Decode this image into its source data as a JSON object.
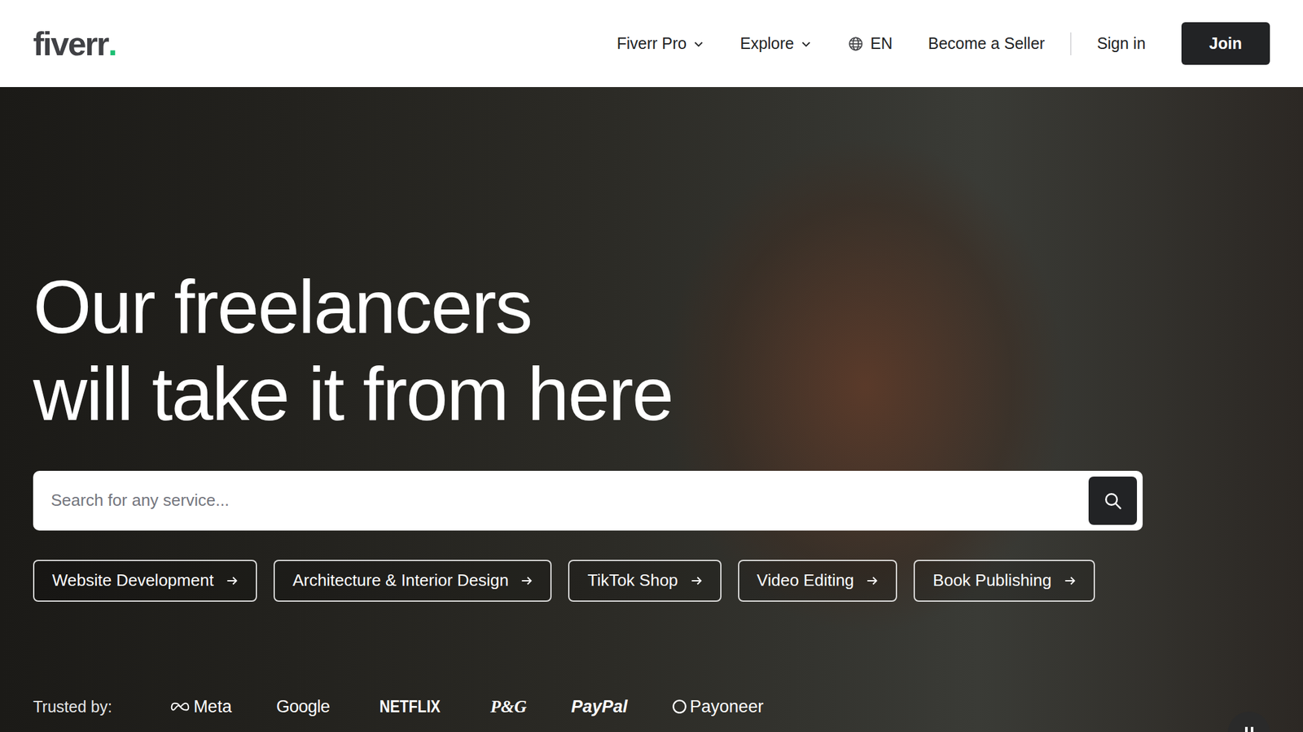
{
  "brand": {
    "name": "fiverr",
    "dot": "."
  },
  "nav": [
    {
      "label": "Fiverr Pro",
      "kind": "dropdown"
    },
    {
      "label": "Explore",
      "kind": "dropdown"
    },
    {
      "label": "EN",
      "kind": "language"
    },
    {
      "label": "Become a Seller",
      "kind": "link"
    },
    {
      "label": "Sign in",
      "kind": "link"
    }
  ],
  "join_button": "Join",
  "hero": {
    "headline": [
      "Our freelancers",
      "will take it from here"
    ]
  },
  "search": {
    "placeholder": "Search for any service..."
  },
  "chips": [
    "Website Development",
    "Architecture & Interior Design",
    "TikTok Shop",
    "Video Editing",
    "Book Publishing"
  ],
  "trusted": {
    "label": "Trusted by:",
    "logos": [
      {
        "name": "Meta",
        "kind": "meta"
      },
      {
        "name": "Google",
        "kind": "google"
      },
      {
        "name": "NETFLIX",
        "kind": "netflix"
      },
      {
        "name": "P&G",
        "kind": "pg"
      },
      {
        "name": "PayPal",
        "kind": "paypal"
      },
      {
        "name": "Payoneer",
        "kind": "payoneer"
      }
    ]
  }
}
